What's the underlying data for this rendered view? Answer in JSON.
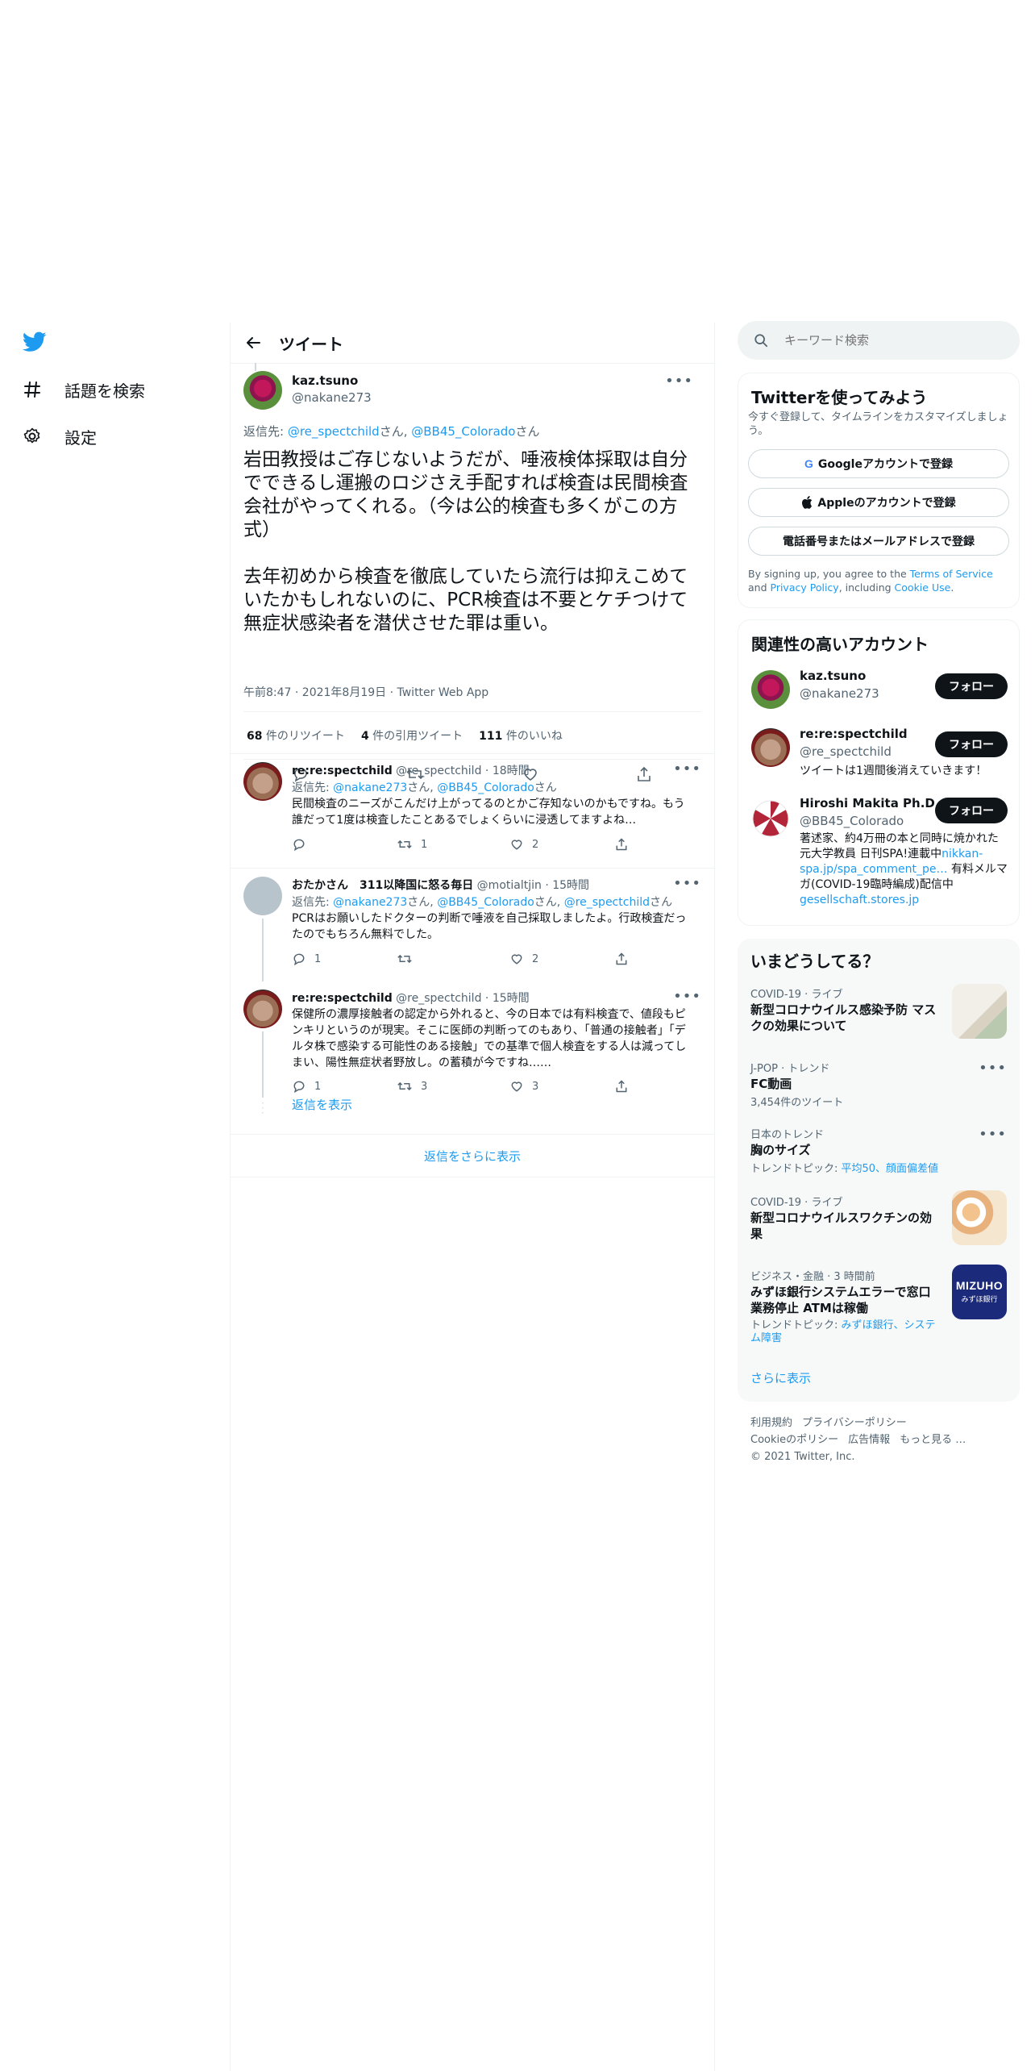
{
  "nav": {
    "explore_label": "話題を検索",
    "settings_label": "設定"
  },
  "header": {
    "title": "ツイート"
  },
  "main_tweet": {
    "display_name": "kaz.tsuno",
    "handle": "@nakane273",
    "reply_to_prefix": "返信先: ",
    "reply_to_1": "@re_spectchild",
    "san1": "さん, ",
    "reply_to_2": "@BB45_Colorado",
    "san2": "さん",
    "paragraph1": "岩田教授はご存じないようだが、唾液検体採取は自分でできるし運搬のロジさえ手配すれば検査は民間検査会社がやってくれる。（今は公的検査も多くがこの方式）",
    "paragraph2": "去年初めから検査を徹底していたら流行は抑えこめていたかもしれないのに、PCR検査は不要とケチつけて無症状感染者を潜伏させた罪は重い。",
    "timestamp": "午前8:47 · 2021年8月19日 · Twitter Web App",
    "stats": {
      "retweets_count": "68",
      "retweets_label": " 件のリツイート",
      "quotes_count": "4",
      "quotes_label": " 件の引用ツイート",
      "likes_count": "111",
      "likes_label": " 件のいいね"
    }
  },
  "replies": [
    {
      "display_name": "re:re:spectchild",
      "handle_time": " @re_spectchild · 18時間",
      "reply_prefix": "返信先: ",
      "mentions": [
        "@nakane273",
        "@BB45_Colorado"
      ],
      "sans": [
        "さん, ",
        "さん"
      ],
      "text": "民間検査のニーズがこんだけ上がってるのとかご存知ないのかもですね。もう誰だって1度は検査したことあるでしょくらいに浸透してますよね…",
      "reply_count": "",
      "retweet_count": "1",
      "like_count": "2"
    },
    {
      "display_name": "おたかさん　311以降国に怒る毎日",
      "handle_time": " @motialtjin · 15時間",
      "reply_prefix": "返信先: ",
      "mentions": [
        "@nakane273",
        "@BB45_Colorado",
        "@re_spectchild"
      ],
      "sans": [
        "さん, ",
        "さん, ",
        "さん"
      ],
      "text": "PCRはお願いしたドクターの判断で唾液を自己採取しましたよ。行政検査だったのでもちろん無料でした。",
      "reply_count": "1",
      "retweet_count": "",
      "like_count": "2"
    },
    {
      "display_name": "re:re:spectchild",
      "handle_time": " @re_spectchild · 15時間",
      "text": "保健所の濃厚接触者の認定から外れると、今の日本では有料検査で、値段もピンキリというのが現実。そこに医師の判断ってのもあり、「普通の接触者」「デルタ株で感染する可能性のある接触」での基準で個人検査をする人は減ってしまい、陽性無症状者野放し。の蓄積が今ですね……",
      "reply_count": "1",
      "retweet_count": "3",
      "like_count": "3"
    }
  ],
  "show_replies": "返信を表示",
  "show_more_replies": "返信をさらに表示",
  "search": {
    "placeholder": "キーワード検索"
  },
  "signup": {
    "title": "Twitterを使ってみよう",
    "subtitle": "今すぐ登録して、タイムラインをカスタマイズしましょう。",
    "google": "Googleアカウントで登録",
    "apple": "Appleのアカウントで登録",
    "phone": "電話番号またはメールアドレスで登録",
    "legal_1": "By signing up, you agree to the ",
    "legal_terms": "Terms of Service",
    "legal_2": " and ",
    "legal_privacy": "Privacy Policy",
    "legal_3": ", including ",
    "legal_cookie": "Cookie Use",
    "legal_4": "."
  },
  "relevant": {
    "title": "関連性の高いアカウント",
    "follow": "フォロー",
    "accounts": [
      {
        "name": "kaz.tsuno",
        "handle": "@nakane273",
        "bio": ""
      },
      {
        "name": "re:re:spectchild",
        "handle": "@re_spectchild",
        "bio": "ツイートは1週間後消えていきます！"
      },
      {
        "name": "Hiroshi Makita Ph.D.",
        "handle": "@BB45_Colorado",
        "bio_1": "著述家、約4万冊の本と同時に焼かれた元大学教員 日刊SPA!連載中",
        "bio_link1": "nikkan-spa.jp/spa_comment_pe…",
        "bio_2": " 有料メルマガ(COVID-19臨時編成)配信中 ",
        "bio_link2": "gesellschaft.stores.jp"
      }
    ]
  },
  "trends": {
    "title": "いまどうしてる？",
    "items": [
      {
        "category": "COVID-19 · ライブ",
        "title": "新型コロナウイルス感染予防 マスクの効果について"
      },
      {
        "category": "J-POP · トレンド",
        "title": "FC動画",
        "sub": "3,454件のツイート"
      },
      {
        "category": "日本のトレンド",
        "title": "胸のサイズ",
        "sub_prefix": "トレンドトピック: ",
        "sub_links": "平均50、顔面偏差値"
      },
      {
        "category": "COVID-19 · ライブ",
        "title": "新型コロナウイルスワクチンの効果"
      },
      {
        "category": "ビジネス・金融 · 3 時間前",
        "title": "みずほ銀行システムエラーで窓口業務停止 ATMは稼働",
        "sub_prefix": "トレンドトピック: ",
        "sub_links": "みずほ銀行、システム障害"
      }
    ],
    "show_more": "さらに表示"
  },
  "thumb_text": {
    "mizuho_brand": "MIZUHO",
    "mizuho_bank": "みずほ銀行"
  },
  "footer": {
    "terms": "利用規約",
    "privacy": "プライバシーポリシー",
    "cookie": "Cookieのポリシー",
    "ads": "広告情報",
    "more": "もっと見る …",
    "copyright": "© 2021 Twitter, Inc."
  },
  "colors": {
    "accent": "#1d9bf0",
    "text": "#0f1419",
    "muted": "#536471",
    "panel": "#f7f9f9",
    "border": "#eff3f4"
  }
}
